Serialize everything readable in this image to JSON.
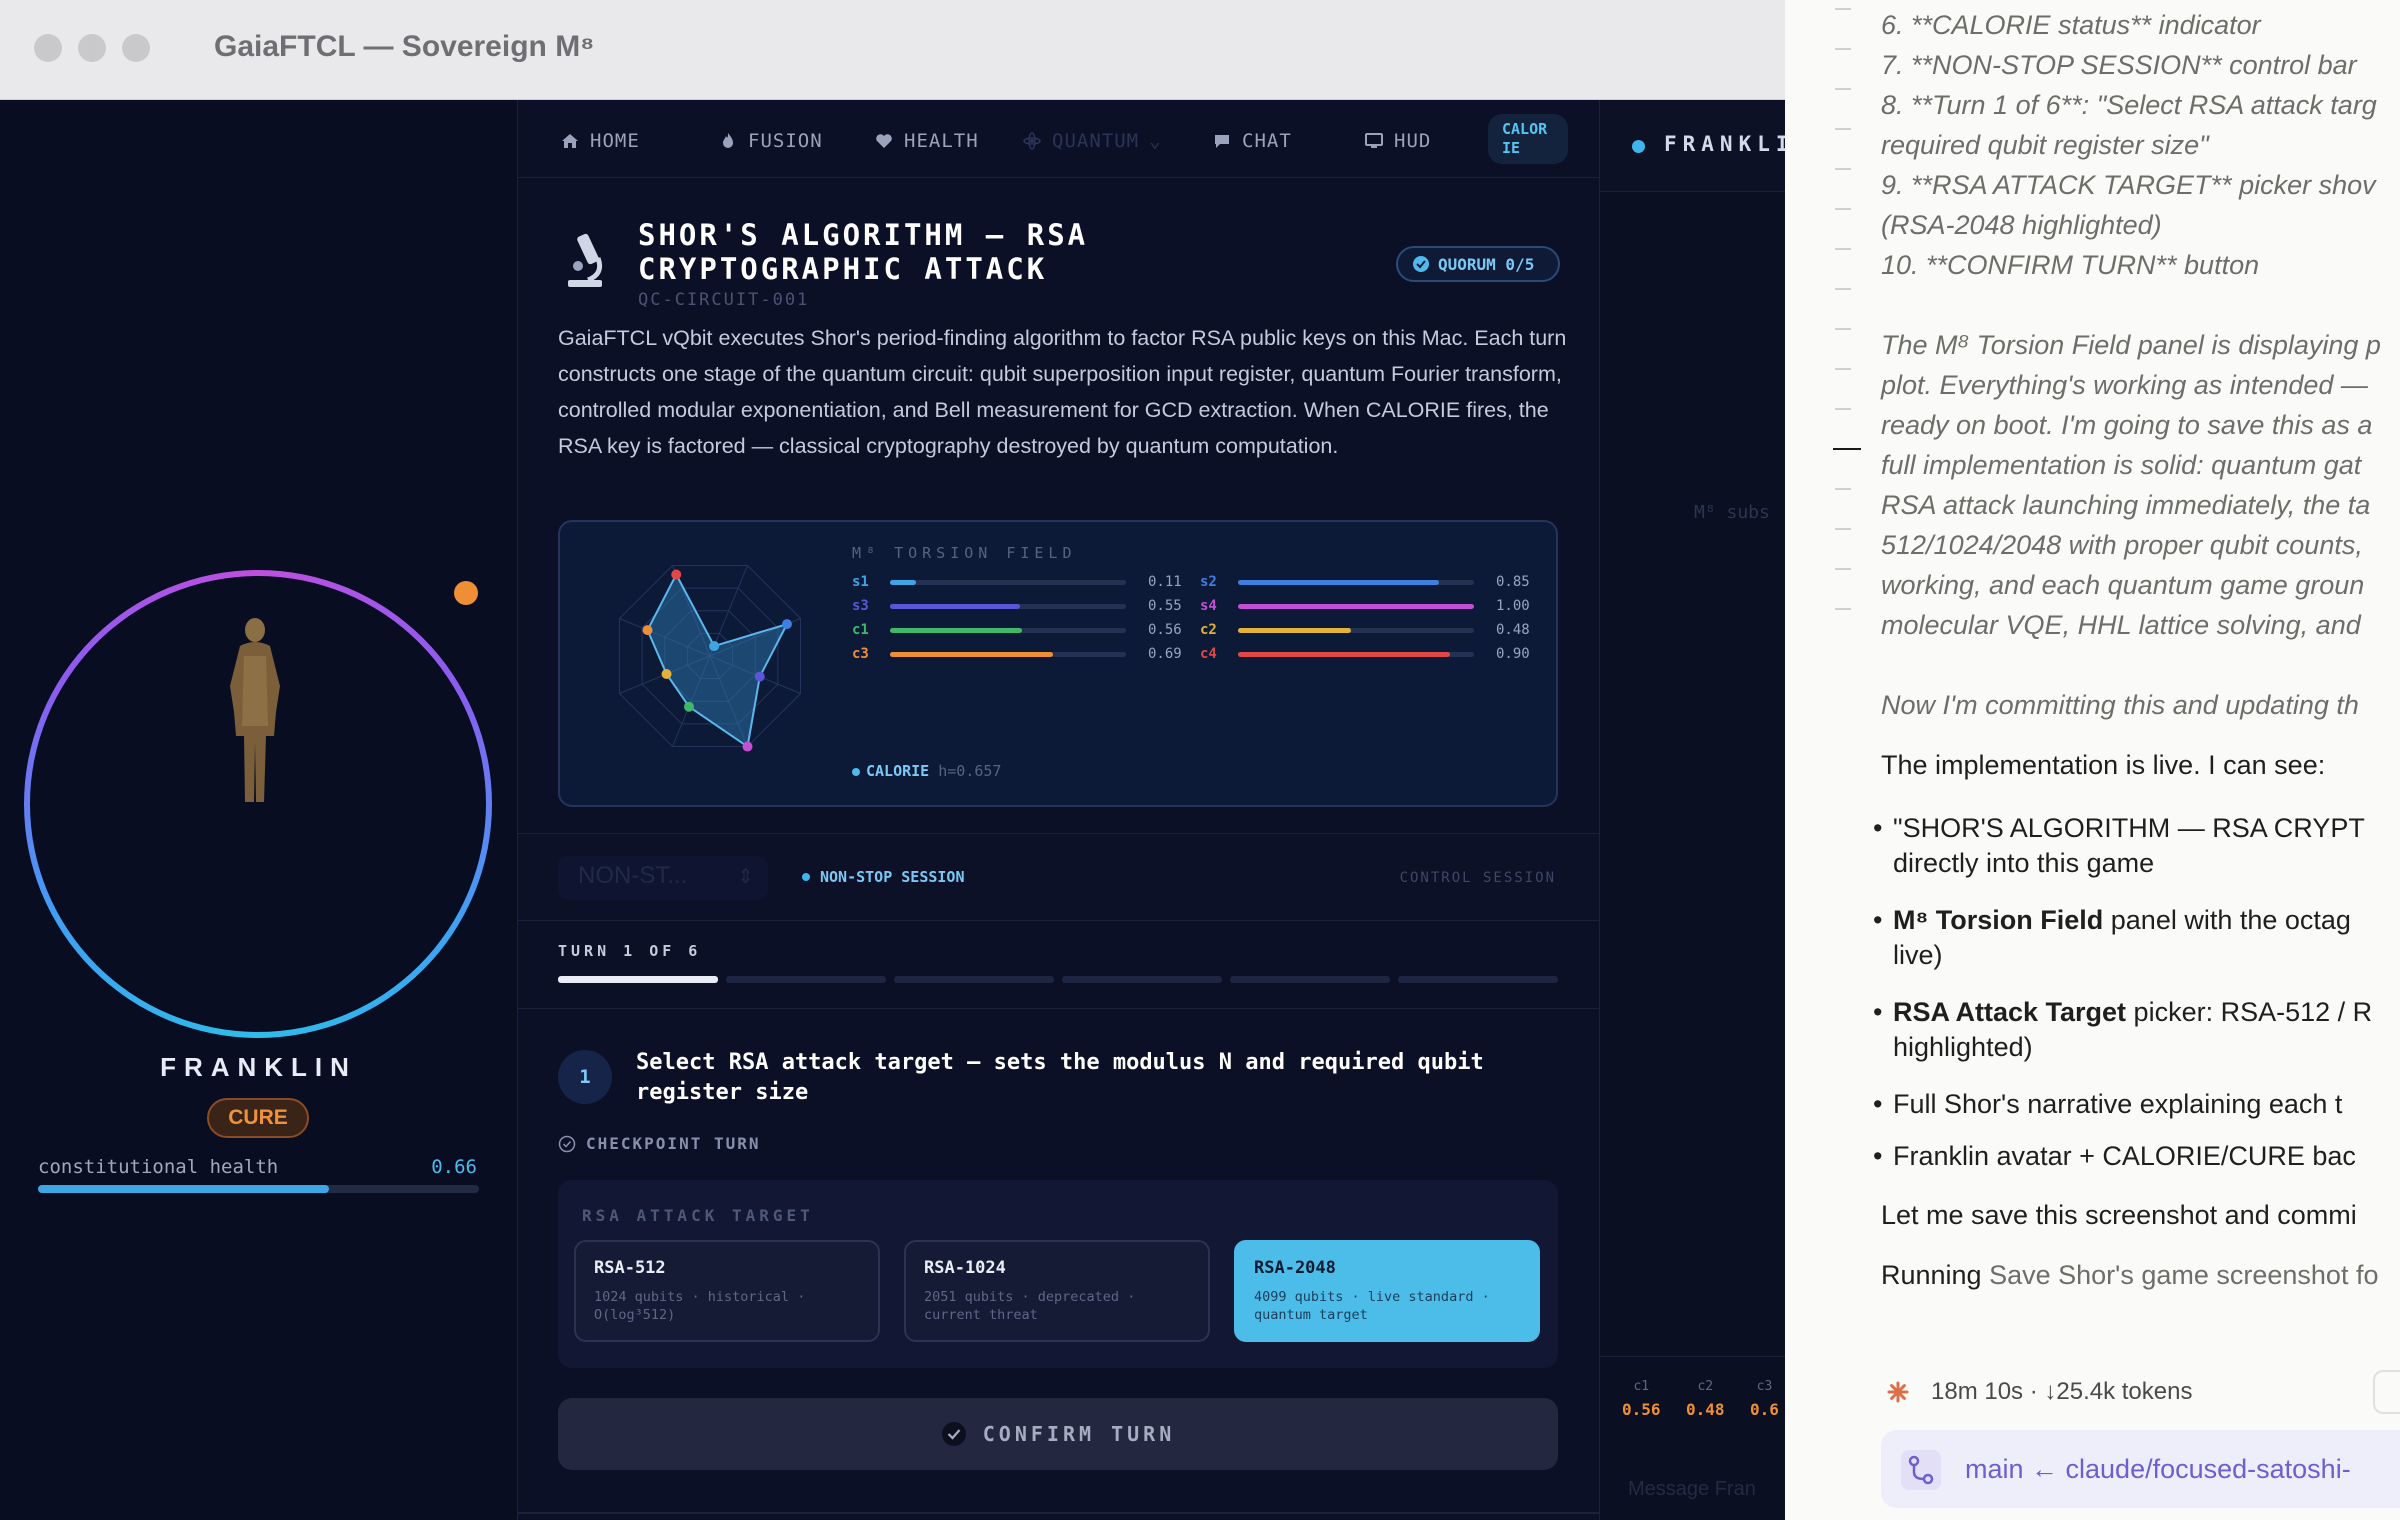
{
  "window": {
    "title": "GaiaFTCL — Sovereign M⁸"
  },
  "avatar": {
    "name": "FRANKLIN",
    "badge": "CURE",
    "health_label": "constitutional health",
    "health_value": "0.66",
    "health_fraction": 0.66
  },
  "nav": {
    "items": [
      {
        "label": "HOME",
        "icon": "home-icon"
      },
      {
        "label": "FUSION",
        "icon": "flame-icon"
      },
      {
        "label": "HEALTH",
        "icon": "heart-icon"
      },
      {
        "label": "QUANTUM",
        "icon": "atom-icon"
      },
      {
        "label": "CHAT",
        "icon": "chat-bubble-icon"
      },
      {
        "label": "HUD",
        "icon": "monitor-icon"
      }
    ],
    "calorie_pill": "CALORIE"
  },
  "game": {
    "title": "SHOR'S ALGORITHM — RSA CRYPTOGRAPHIC ATTACK",
    "id": "QC-CIRCUIT-001",
    "quorum": "QUORUM 0/5",
    "description": "GaiaFTCL vQbit executes Shor's period-finding algorithm to factor RSA public keys on this Mac. Each turn constructs one stage of the quantum circuit: qubit superposition input register, quantum Fourier transform, controlled modular exponentiation, and Bell measurement for GCD extraction. When CALORIE fires, the RSA key is factored — classical cryptography destroyed by quantum computation."
  },
  "torsion": {
    "title": "M⁸ TORSION FIELD",
    "rows": [
      {
        "label": "s1",
        "value": 0.11,
        "display": "0.11",
        "color": "#3fa6e6"
      },
      {
        "label": "s2",
        "value": 0.85,
        "display": "0.85",
        "color": "#3f7fe0"
      },
      {
        "label": "s3",
        "value": 0.55,
        "display": "0.55",
        "color": "#5b56d8"
      },
      {
        "label": "s4",
        "value": 1.0,
        "display": "1.00",
        "color": "#c24fd4"
      },
      {
        "label": "c1",
        "value": 0.56,
        "display": "0.56",
        "color": "#3fb86a"
      },
      {
        "label": "c2",
        "value": 0.48,
        "display": "0.48",
        "color": "#e2b23a"
      },
      {
        "label": "c3",
        "value": 0.69,
        "display": "0.69",
        "color": "#ef8f35"
      },
      {
        "label": "c4",
        "value": 0.9,
        "display": "0.90",
        "color": "#e04848"
      }
    ],
    "calorie_label": "CALORIE",
    "h_value": "h=0.657"
  },
  "session": {
    "mode": "NON-ST...",
    "label": "NON-STOP SESSION",
    "control": "CONTROL SESSION"
  },
  "turn": {
    "label": "TURN 1 OF 6",
    "current": 1,
    "total": 6
  },
  "step": {
    "number": "1",
    "text": "Select RSA attack target — sets the modulus N and required qubit register size",
    "checkpoint": "CHECKPOINT TURN"
  },
  "target": {
    "title": "RSA ATTACK TARGET",
    "options": [
      {
        "name": "RSA-512",
        "sub": "1024 qubits · historical · O(log³512)",
        "selected": false
      },
      {
        "name": "RSA-1024",
        "sub": "2051 qubits · deprecated · current threat",
        "selected": false
      },
      {
        "name": "RSA-2048",
        "sub": "4099 qubits · live standard · quantum target",
        "selected": true
      }
    ]
  },
  "confirm": {
    "label": "CONFIRM TURN"
  },
  "side": {
    "name": "FRANKLI",
    "sub": "M⁸ subs",
    "stats": [
      {
        "label": "c1",
        "value": "0.56"
      },
      {
        "label": "c2",
        "value": "0.48"
      },
      {
        "label": "c3",
        "value": "0.6"
      }
    ],
    "message": "Message Fran"
  },
  "chat": {
    "list_lines": [
      "6. **CALORIE status** indicator",
      "7. **NON-STOP SESSION** control bar",
      "8. **Turn 1 of 6**: \"Select RSA attack targ",
      "required qubit register size\"",
      "9. **RSA ATTACK TARGET** picker shov",
      "(RSA-2048 highlighted)",
      "10. **CONFIRM TURN** button"
    ],
    "para_lines": [
      "The M⁸ Torsion Field panel is displaying p",
      "plot. Everything's working as intended —",
      "ready on boot. I'm going to save this as a",
      "full implementation is solid: quantum gat",
      "RSA attack launching immediately, the ta",
      "512/1024/2048 with proper qubit counts,",
      "working, and each quantum game groun",
      "molecular VQE, HHL lattice solving, and"
    ],
    "commit_line": "Now I'm committing this and updating th",
    "live_line": "The implementation is live. I can see:",
    "bullets": [
      {
        "bold": "",
        "text": "\"SHOR'S ALGORITHM — RSA CRYPT"
      },
      {
        "bold": "",
        "text": "directly into this game"
      },
      {
        "bold": "M⁸ Torsion Field",
        "text": " panel with the octag"
      },
      {
        "bold": "",
        "text": "live)"
      },
      {
        "bold": "RSA Attack Target",
        "text": " picker: RSA-512 / R"
      },
      {
        "bold": "",
        "text": "highlighted)"
      },
      {
        "bold": "",
        "text": "Full Shor's narrative explaining each t"
      },
      {
        "bold": "",
        "text": "Franklin avatar + CALORIE/CURE bac"
      }
    ],
    "save_line": "Let me save this screenshot and commi",
    "running_label": "Running",
    "running_cmd": "Save Shor's game screenshot fo",
    "timer": "18m 10s · ↓25.4k tokens",
    "branch": "main ← claude/focused-satoshi-"
  }
}
